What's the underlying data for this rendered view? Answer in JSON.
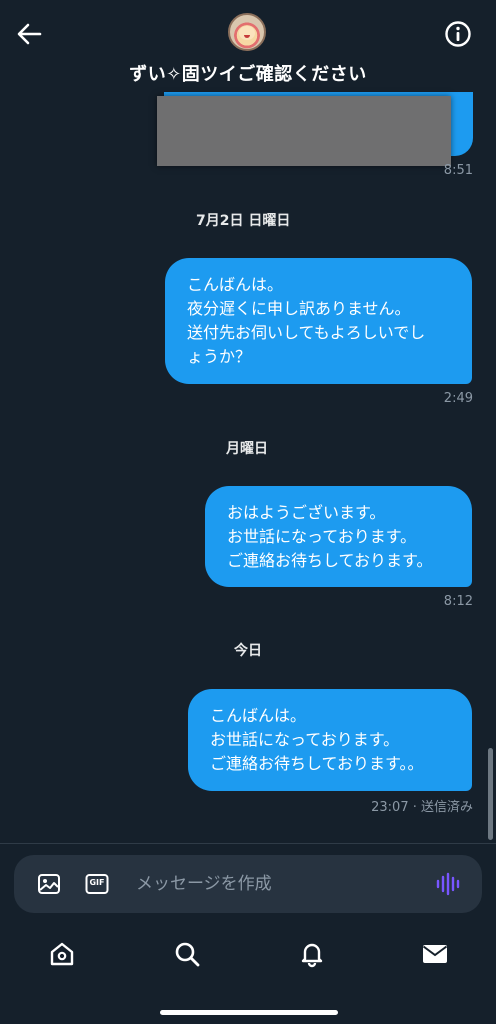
{
  "header": {
    "title": "ずい✧固ツイご確認ください",
    "back_icon": "arrow-left-icon",
    "info_icon": "info-icon"
  },
  "messages": [
    {
      "type": "image",
      "redacted": true,
      "time": "8:51"
    },
    {
      "type": "date",
      "label": "7月2日 日曜日"
    },
    {
      "type": "text",
      "lines": [
        "こんばんは。",
        "夜分遅くに申し訳ありません。",
        "送付先お伺いしてもよろしいでし",
        "ょうか？"
      ],
      "time": "2:49"
    },
    {
      "type": "date",
      "label": "月曜日"
    },
    {
      "type": "text",
      "lines": [
        "おはようございます。",
        "お世話になっております。",
        "ご連絡お待ちしております。"
      ],
      "time": "8:12"
    },
    {
      "type": "date",
      "label": "今日"
    },
    {
      "type": "text",
      "lines": [
        "こんばんは。",
        "お世話になっております。",
        "ご連絡お待ちしております。。"
      ],
      "time": "23:07 · 送信済み"
    }
  ],
  "composer": {
    "placeholder": "メッセージを作成",
    "image_icon": "image-icon",
    "gif_label": "GIF",
    "voice_icon": "voice-waveform-icon"
  },
  "nav": {
    "items": [
      "home-icon",
      "search-icon",
      "bell-icon",
      "mail-icon"
    ]
  },
  "colors": {
    "background": "#15202b",
    "bubble": "#1d9bf0",
    "composer": "#273340",
    "muted": "#8b98a5",
    "voice_accent": "#7856ff"
  }
}
